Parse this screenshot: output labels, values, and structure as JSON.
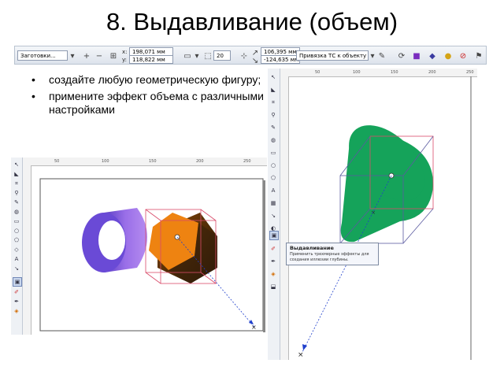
{
  "slide": {
    "title": "8. Выдавливание (объем)",
    "bullets": [
      "создайте любую геометрическую фигуру;",
      "примените эффект объема с различными настройками"
    ]
  },
  "property_bar": {
    "preset_dropdown": "Заготовки...",
    "x_label": "x:",
    "x_value": "198,071 мм",
    "y_label": "y:",
    "y_value": "118,822 мм",
    "depth_value": "20",
    "vp_x_value": "106,395 мм",
    "vp_y_value": "-124,635 мм",
    "vp_lock_dropdown": "Привязка ТС к объекту"
  },
  "left_pane": {
    "ruler_numbers": [
      "50",
      "100",
      "150",
      "200",
      "250"
    ],
    "shapes": {
      "cylinder_colors": [
        "#5b3fc4",
        "#9a6fe8",
        "#b58cf0"
      ],
      "pentagon_front": "#ee8311",
      "pentagon_dark": "#2e1a08"
    }
  },
  "right_pane": {
    "ruler_numbers": [
      "50",
      "100",
      "150",
      "200",
      "250"
    ],
    "shapes": {
      "extrude_fill": "#15a35a"
    }
  },
  "tooltip": {
    "title": "Выдавливание",
    "text": "Применить трехмерные эффекты для создания иллюзии глубины."
  },
  "colors": {
    "accent": "#1f3fcc",
    "bbox": "#d94b6a"
  }
}
